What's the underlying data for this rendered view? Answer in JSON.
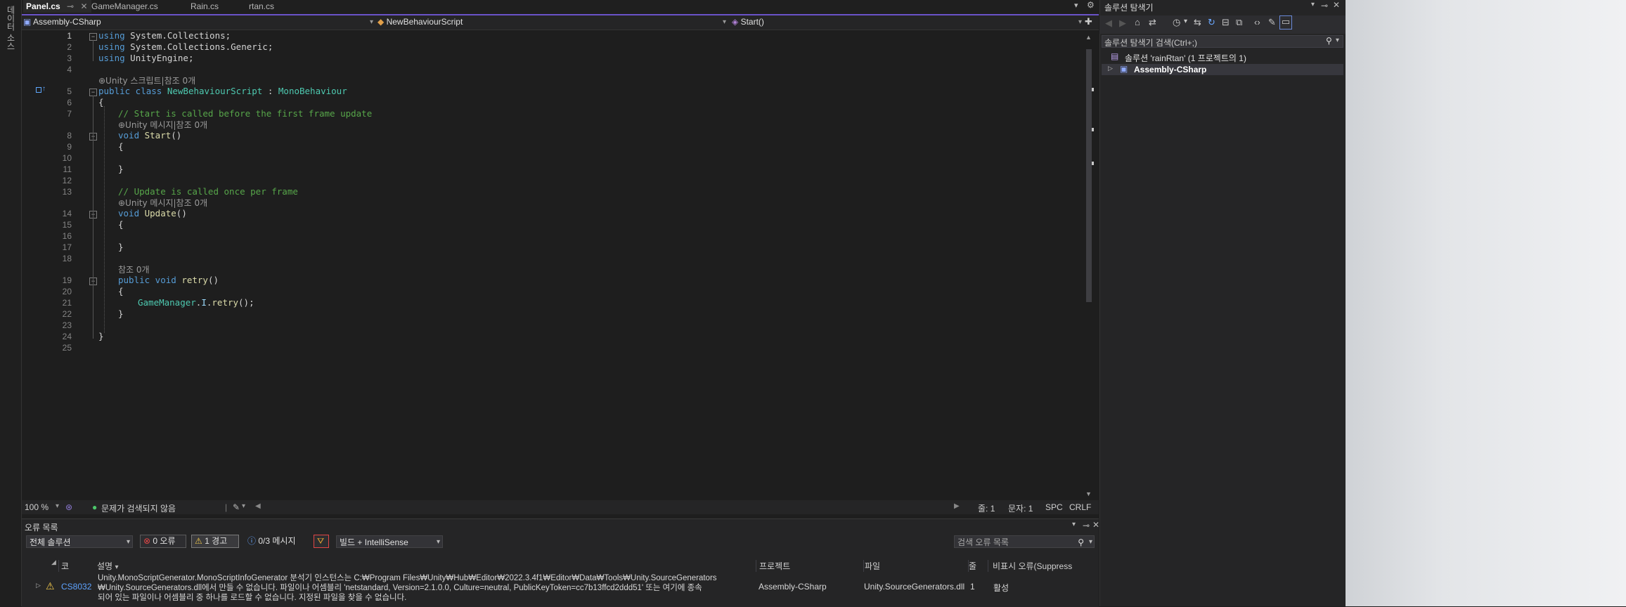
{
  "left_strip": {
    "label": "데이터 소스"
  },
  "tabs": [
    {
      "label": "Panel.cs",
      "active": true
    },
    {
      "label": "GameManager.cs",
      "active": false
    },
    {
      "label": "Rain.cs",
      "active": false
    },
    {
      "label": "rtan.cs",
      "active": false
    }
  ],
  "navbar": {
    "project": "Assembly-CSharp",
    "class": "NewBehaviourScript",
    "member": "Start()"
  },
  "editor": {
    "lines": [
      "1",
      "2",
      "3",
      "4",
      "5",
      "6",
      "7",
      "8",
      "9",
      "10",
      "11",
      "12",
      "13",
      "14",
      "15",
      "16",
      "17",
      "18",
      "19",
      "20",
      "21",
      "22",
      "23",
      "24",
      "25"
    ],
    "code": {
      "l1_kw": "using",
      "l1_rest": " System.Collections;",
      "l2_kw": "using",
      "l2_rest": " System.Collections.Generic;",
      "l3_kw": "using",
      "l3_rest": " UnityEngine;",
      "hint_class": "⊕Unity 스크립트|참조 0개",
      "l5_kw": "public class",
      "l5_name": " NewBehaviourScript",
      "l5_colon": " : ",
      "l5_base": "MonoBehaviour",
      "l6": "{",
      "l7_comment": "// Start is called before the first frame update",
      "hint_start": "⊕Unity 메시지|참조 0개",
      "l8_kw": "void",
      "l8_name": " Start",
      "l8_paren": "()",
      "l9": "{",
      "l11": "}",
      "l13_comment": "// Update is called once per frame",
      "hint_update": "⊕Unity 메시지|참조 0개",
      "l14_kw": "void",
      "l14_name": " Update",
      "l14_paren": "()",
      "l15": "{",
      "l17": "}",
      "hint_retry": "참조 0개",
      "l19_kw": "public void",
      "l19_name": " retry",
      "l19_paren": "()",
      "l20": "{",
      "l21_obj": "GameManager",
      "l21_dot1": ".",
      "l21_field": "I",
      "l21_dot2": ".",
      "l21_call": "retry",
      "l21_end": "();",
      "l22": "}",
      "l24": "}"
    }
  },
  "editor_status": {
    "zoom": "100 %",
    "issues": "문제가 검색되지 않음",
    "line": "줄: 1",
    "char": "문자: 1",
    "whitespace": "SPC",
    "eol": "CRLF"
  },
  "error_list": {
    "title": "오류 목록",
    "scope": "전체 솔루션",
    "errors": "0 오류",
    "warnings": "1 경고",
    "messages": "0/3 메시지",
    "build_filter": "빌드 + IntelliSense",
    "search_placeholder": "검색 오류 목록",
    "columns": {
      "code": "코드",
      "description": "설명",
      "project": "프로젝트",
      "file": "파일",
      "line": "줄",
      "suppress": "비표시 오류(Suppress"
    },
    "rows": [
      {
        "code": "CS8032",
        "desc1": "Unity.MonoScriptGenerator.MonoScriptInfoGenerator 분석기 인스턴스는 C:₩Program Files₩Unity₩Hub₩Editor₩2022.3.4f1₩Editor₩Data₩Tools₩Unity.SourceGenerators",
        "desc2": "₩Unity.SourceGenerators.dll에서 만들 수 없습니다. 파일이나 어셈블리 'netstandard, Version=2.1.0.0, Culture=neutral, PublicKeyToken=cc7b13ffcd2ddd51' 또는 여기에 종속",
        "desc3": "되어 있는 파일이나 어셈블리 중 하나를 로드할 수 없습니다. 지정된 파일을 찾을 수 없습니다.",
        "project": "Assembly-CSharp",
        "file": "Unity.SourceGenerators.dll",
        "line": "1",
        "suppress": "활성"
      }
    ]
  },
  "solution_explorer": {
    "title": "솔루션 탐색기",
    "search_placeholder": "솔루션 탐색기 검색(Ctrl+;)",
    "solution": "솔루션 'rainRtan' (1 프로젝트의 1)",
    "project": "Assembly-CSharp"
  },
  "colors": {
    "accent": "#6a52c8",
    "keyword": "#569cd6",
    "type": "#4ec9b0",
    "comment": "#57a64a",
    "warning": "#f2c94c",
    "error": "#e04545"
  }
}
